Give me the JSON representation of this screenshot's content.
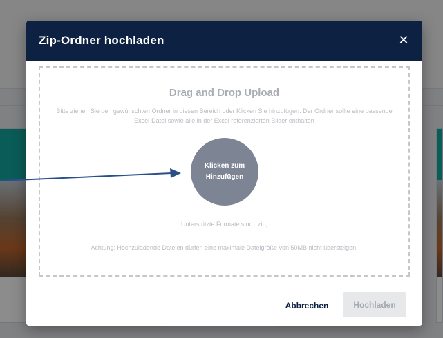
{
  "modal": {
    "title": "Zip-Ordner hochladen",
    "close_icon": "close-icon"
  },
  "dropzone": {
    "title": "Drag and Drop Upload",
    "description": "Bitte ziehen Sie den gewünschten Ordner in diesen Bereich oder Klicken Sie hinzufügen. Der Ordner sollte eine passende Excel-Datei sowie alle in der Excel referenzierten Bilder enthalten",
    "circle_label_line1": "Klicken zum",
    "circle_label_line2": "Hinzufügen",
    "formats": "Unterstützte Formate sind: .zip,",
    "warning": "Achtung: Hochzuladende Dateien dürfen eine maximale Dateigröße von 50MB nicht übersteigen."
  },
  "footer": {
    "cancel_label": "Abbrechen",
    "upload_label": "Hochladen"
  },
  "colors": {
    "header": "#0d2143",
    "circle": "#7d8594",
    "annotation_arrow": "#2c4f8a"
  }
}
